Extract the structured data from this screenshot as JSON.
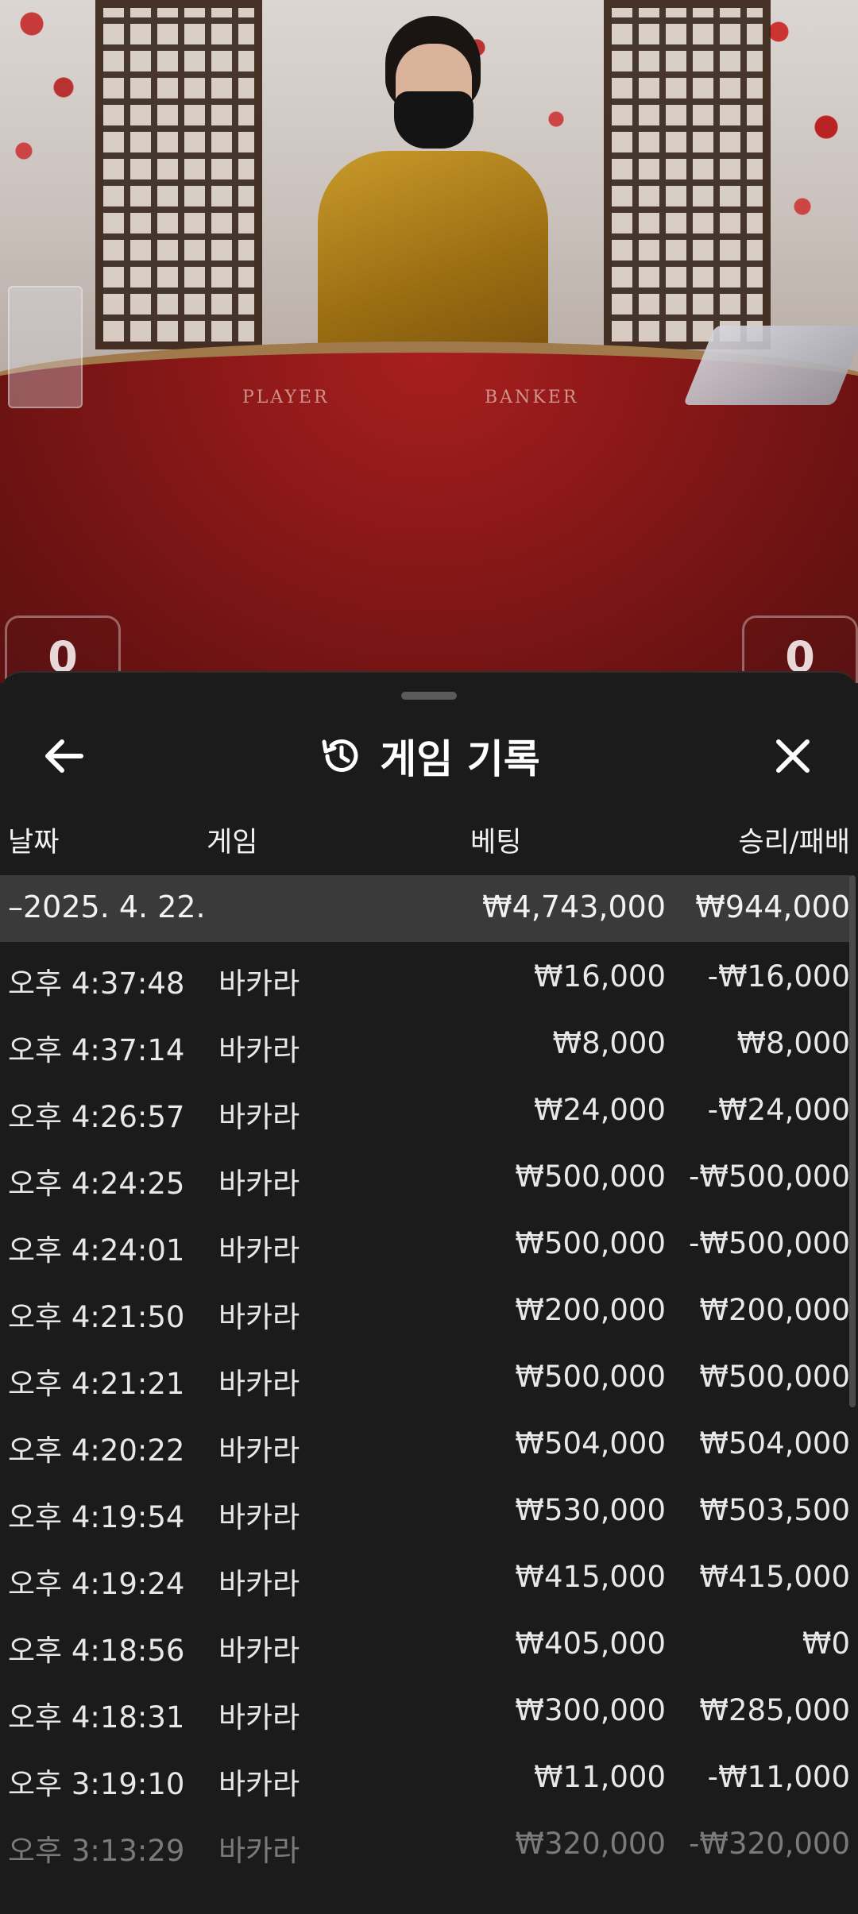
{
  "video": {
    "table_label_player": "PLAYER",
    "table_label_banker": "BANKER",
    "player_score": "0",
    "banker_score": "0"
  },
  "sheet": {
    "title": "게임 기록",
    "icons": {
      "back": "arrow-left-icon",
      "history": "history-icon",
      "close": "close-icon"
    }
  },
  "columns": {
    "date": "날짜",
    "game": "게임",
    "bet": "베팅",
    "win_loss": "승리/패배"
  },
  "day_summary": {
    "date": "–2025. 4. 22.",
    "bet": "₩4,743,000",
    "win_loss": "₩944,000"
  },
  "rows": [
    {
      "time": "오후 4:37:48",
      "game": "바카라",
      "bet": "₩16,000",
      "win_loss": "-₩16,000"
    },
    {
      "time": "오후 4:37:14",
      "game": "바카라",
      "bet": "₩8,000",
      "win_loss": "₩8,000"
    },
    {
      "time": "오후 4:26:57",
      "game": "바카라",
      "bet": "₩24,000",
      "win_loss": "-₩24,000"
    },
    {
      "time": "오후 4:24:25",
      "game": "바카라",
      "bet": "₩500,000",
      "win_loss": "-₩500,000"
    },
    {
      "time": "오후 4:24:01",
      "game": "바카라",
      "bet": "₩500,000",
      "win_loss": "-₩500,000"
    },
    {
      "time": "오후 4:21:50",
      "game": "바카라",
      "bet": "₩200,000",
      "win_loss": "₩200,000"
    },
    {
      "time": "오후 4:21:21",
      "game": "바카라",
      "bet": "₩500,000",
      "win_loss": "₩500,000"
    },
    {
      "time": "오후 4:20:22",
      "game": "바카라",
      "bet": "₩504,000",
      "win_loss": "₩504,000"
    },
    {
      "time": "오후 4:19:54",
      "game": "바카라",
      "bet": "₩530,000",
      "win_loss": "₩503,500"
    },
    {
      "time": "오후 4:19:24",
      "game": "바카라",
      "bet": "₩415,000",
      "win_loss": "₩415,000"
    },
    {
      "time": "오후 4:18:56",
      "game": "바카라",
      "bet": "₩405,000",
      "win_loss": "₩0"
    },
    {
      "time": "오후 4:18:31",
      "game": "바카라",
      "bet": "₩300,000",
      "win_loss": "₩285,000"
    },
    {
      "time": "오후 3:19:10",
      "game": "바카라",
      "bet": "₩11,000",
      "win_loss": "-₩11,000"
    },
    {
      "time": "오후 3:13:29",
      "game": "바카라",
      "bet": "₩320,000",
      "win_loss": "-₩320,000"
    }
  ]
}
